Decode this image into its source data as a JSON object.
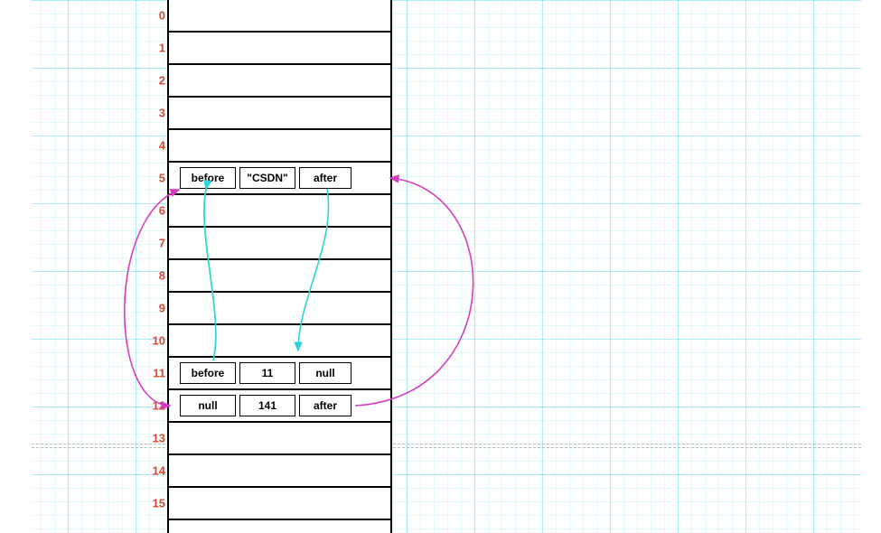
{
  "rows": {
    "count": 16,
    "labels": [
      "0",
      "1",
      "2",
      "3",
      "4",
      "5",
      "6",
      "7",
      "8",
      "9",
      "10",
      "11",
      "12",
      "13",
      "14",
      "15"
    ]
  },
  "nodes": {
    "r5": {
      "before": "before",
      "mid": "\"CSDN\"",
      "after": "after"
    },
    "r11": {
      "before": "before",
      "mid": "11",
      "after": "null"
    },
    "r12": {
      "before": "null",
      "mid": "141",
      "after": "after"
    }
  },
  "colors": {
    "indexColor": "#d84a30",
    "arrowCyan": "#2fd3d6",
    "arrowMagenta": "#d63cc3"
  },
  "arrows": {
    "a_before5_to_before11": {
      "color": "cyan"
    },
    "a_after5_to_mid11": {
      "color": "cyan"
    },
    "a_before12_to_row5L": {
      "color": "magenta"
    },
    "a_after12_to_row5R": {
      "color": "magenta"
    }
  }
}
